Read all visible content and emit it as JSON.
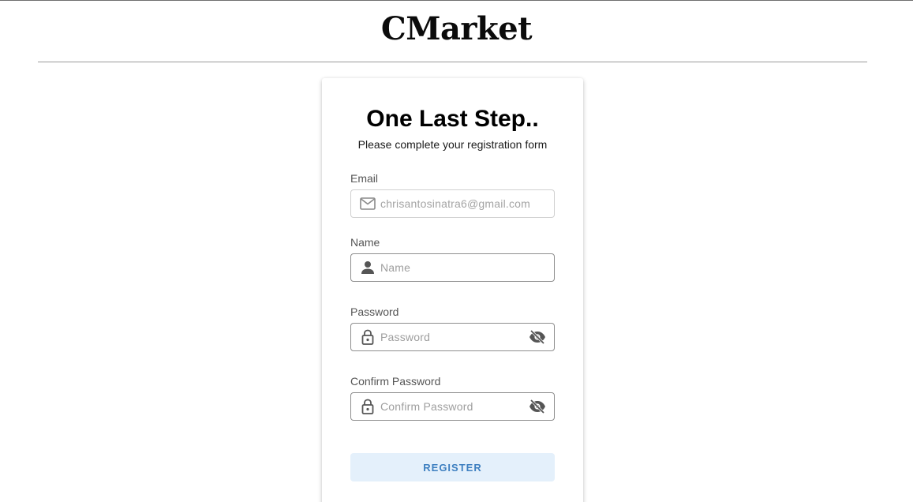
{
  "header": {
    "brand": "CMarket"
  },
  "form": {
    "title": "One Last Step..",
    "subtitle": "Please complete your registration form",
    "email": {
      "label": "Email",
      "value": "chrisantosinatra6@gmail.com",
      "icon": "mail-icon",
      "disabled": true
    },
    "name": {
      "label": "Name",
      "placeholder": "Name",
      "icon": "person-icon"
    },
    "password": {
      "label": "Password",
      "placeholder": "Password",
      "icon": "lock-icon",
      "toggle_icon": "eye-off-icon"
    },
    "confirm_password": {
      "label": "Confirm Password",
      "placeholder": "Confirm Password",
      "icon": "lock-icon",
      "toggle_icon": "eye-off-icon"
    },
    "submit_label": "REGISTER"
  },
  "colors": {
    "button_bg": "#e4f0fb",
    "button_text": "#3d7fc0",
    "field_border": "#8e8e8e",
    "icon": "#666666"
  }
}
